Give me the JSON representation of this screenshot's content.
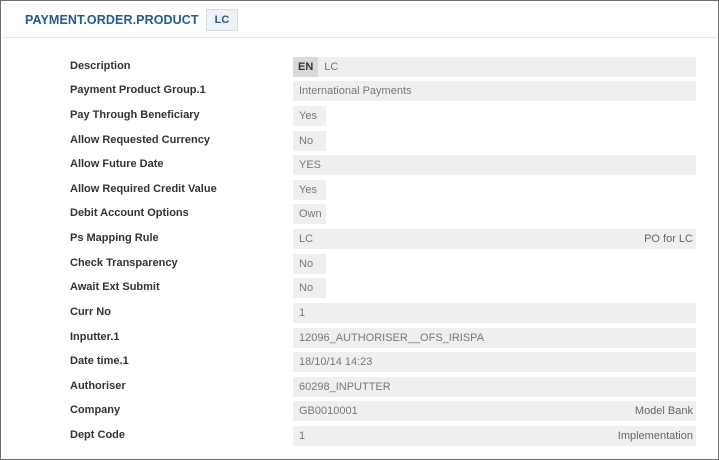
{
  "header": {
    "title": "PAYMENT.ORDER.PRODUCT",
    "record_id": "LC"
  },
  "fields": [
    {
      "label": "Description",
      "lang": "EN",
      "value": "LC",
      "extra": ""
    },
    {
      "label": "Payment Product Group.1",
      "value": "International Payments",
      "extra": ""
    },
    {
      "label": "Pay Through Beneficiary",
      "value": "Yes",
      "extra": ""
    },
    {
      "label": "Allow Requested Currency",
      "value": "No",
      "extra": ""
    },
    {
      "label": "Allow Future Date",
      "value": "YES",
      "extra": ""
    },
    {
      "label": "Allow Required Credit Value",
      "value": "Yes",
      "extra": ""
    },
    {
      "label": "Debit Account Options",
      "value": "Own",
      "extra": ""
    },
    {
      "label": "Ps Mapping Rule",
      "value": "LC",
      "extra": "PO for LC"
    },
    {
      "label": "Check Transparency",
      "value": "No",
      "extra": ""
    },
    {
      "label": "Await Ext Submit",
      "value": "No",
      "extra": ""
    },
    {
      "label": "Curr No",
      "value": "1",
      "extra": ""
    },
    {
      "label": "Inputter.1",
      "value": "12096_AUTHORISER__OFS_IRISPA",
      "extra": ""
    },
    {
      "label": "Date time.1",
      "value": "18/10/14 14:23",
      "extra": ""
    },
    {
      "label": "Authoriser",
      "value": "60298_INPUTTER",
      "extra": ""
    },
    {
      "label": "Company",
      "value": "GB0010001",
      "extra": "Model Bank"
    },
    {
      "label": "Dept Code",
      "value": "1",
      "extra": "Implementation"
    }
  ]
}
